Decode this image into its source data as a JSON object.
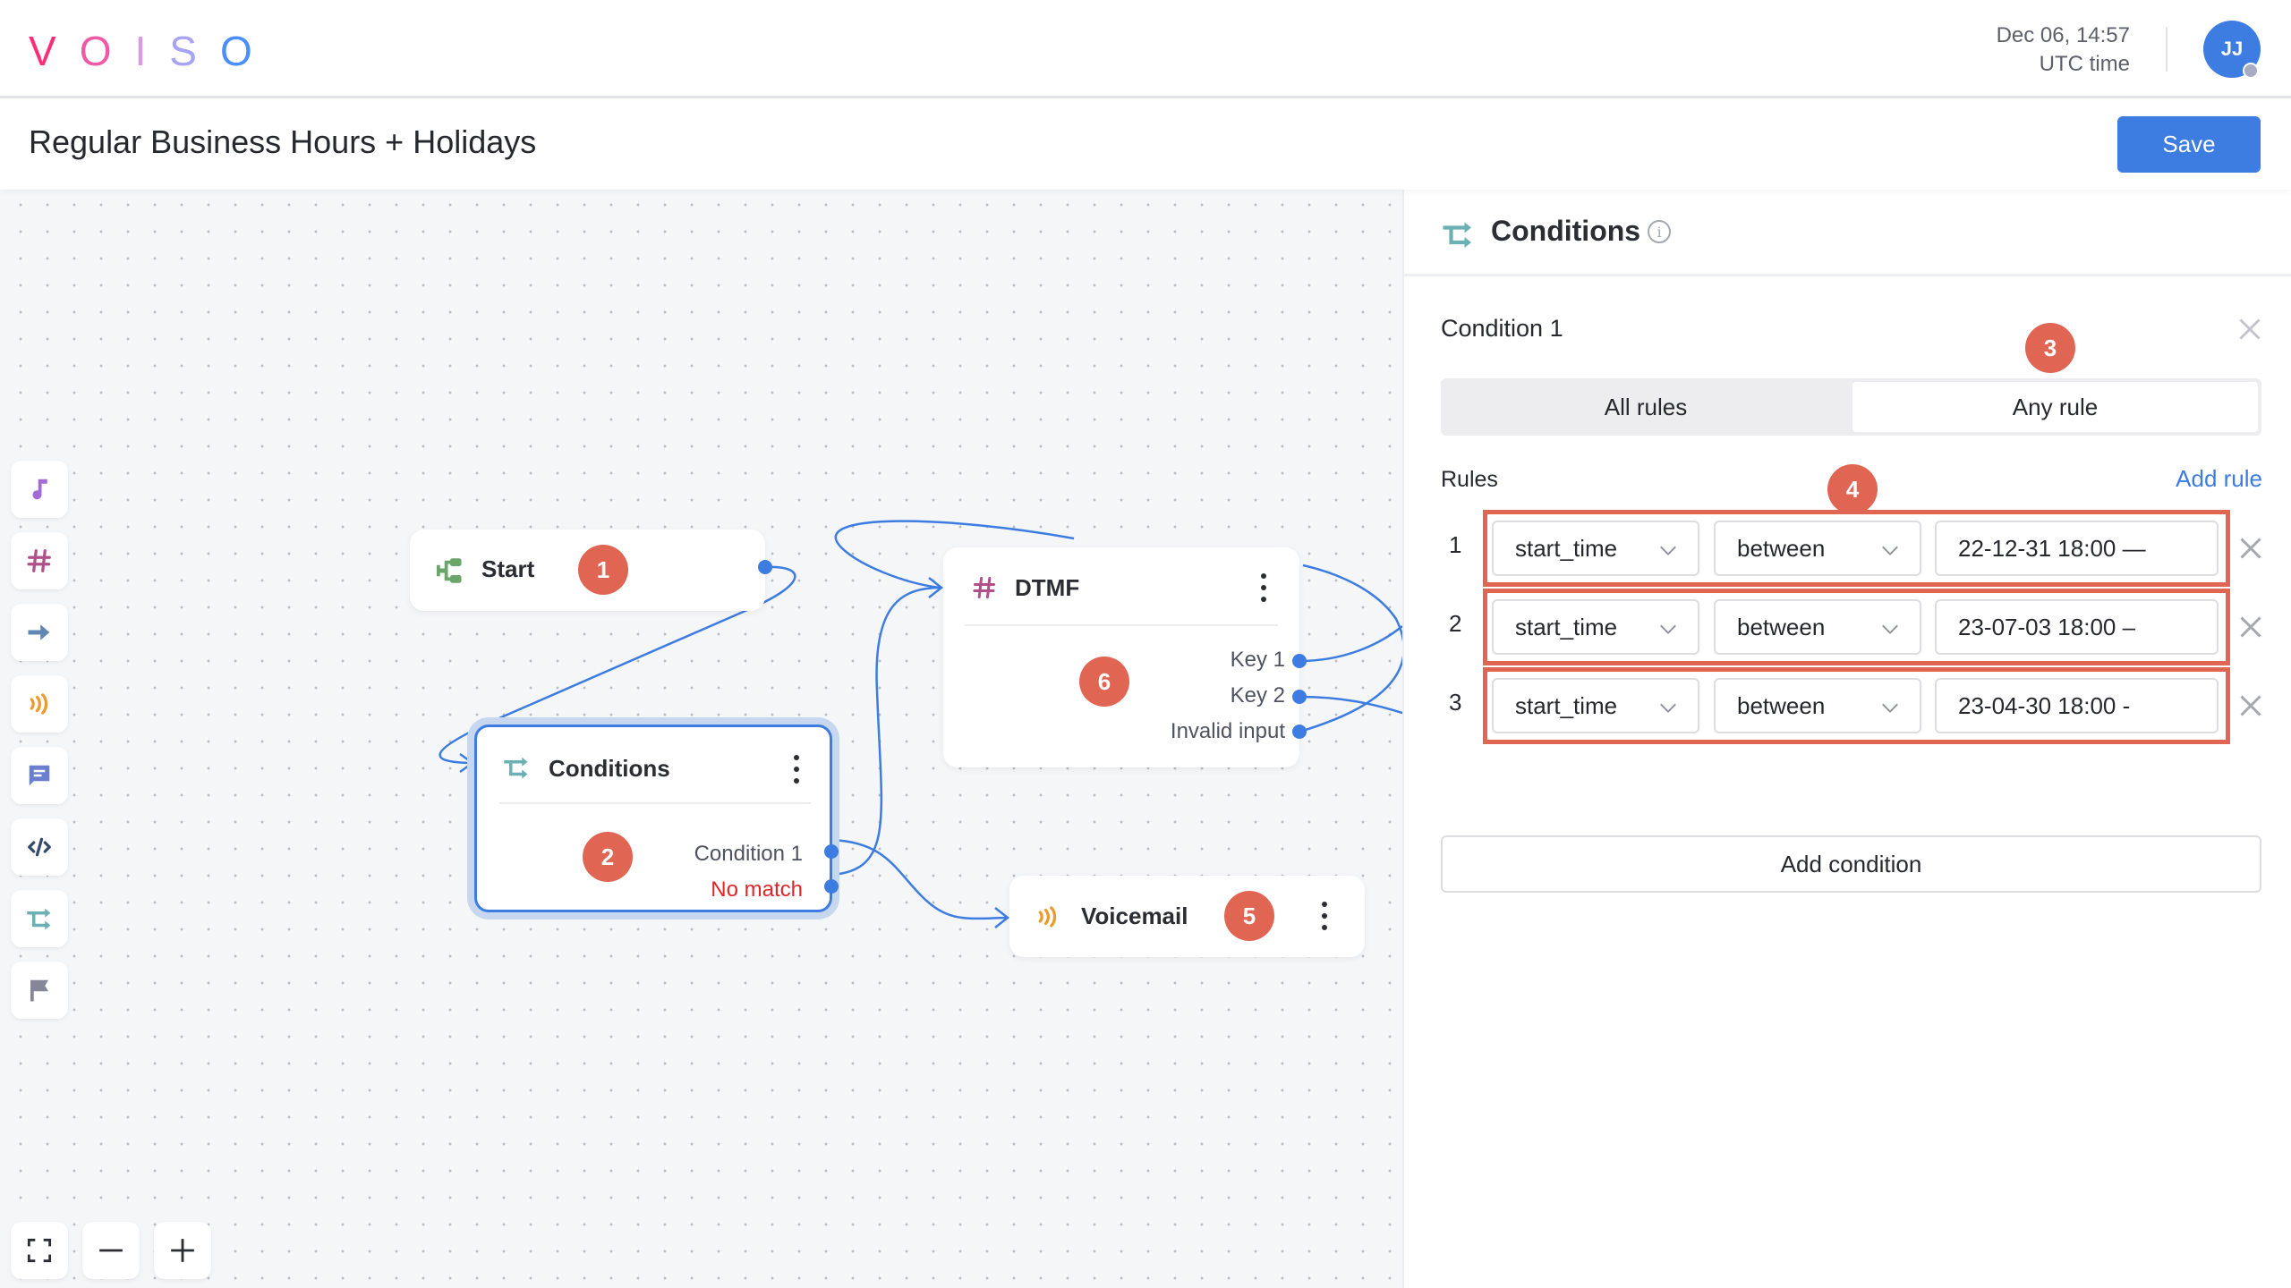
{
  "app": {
    "logo_letters": [
      "V",
      "O",
      "I",
      "S",
      "O"
    ],
    "logo_colors": [
      "#ff2d78",
      "#ef5aa6",
      "#d99be6",
      "#a9a3f6",
      "#4a8ffb"
    ]
  },
  "header": {
    "date_time": "Dec 06, 14:57",
    "timezone": "UTC time",
    "avatar_initials": "JJ",
    "avatar_color": "#3d7ce0",
    "status_color": "#a9abc3"
  },
  "titlebar": {
    "title": "Regular Business Hours + Holidays",
    "save_label": "Save"
  },
  "toolbar": {
    "tools": [
      {
        "icon": "music-note-icon",
        "color": "#a36bd6"
      },
      {
        "icon": "hash-icon",
        "color": "#b0508a"
      },
      {
        "icon": "arrow-right-icon",
        "color": "#5f87b3"
      },
      {
        "icon": "voicemail-waves-icon",
        "color": "#ec9a2b"
      },
      {
        "icon": "message-icon",
        "color": "#6a7fcf"
      },
      {
        "icon": "code-icon",
        "color": "#35496a"
      },
      {
        "icon": "conditions-icon",
        "color": "#6bb0b3"
      },
      {
        "icon": "flag-icon",
        "color": "#85869a"
      }
    ]
  },
  "zoom_controls": {
    "fit": "fit-screen-icon",
    "zoom_out": "minus-icon",
    "zoom_in": "plus-icon"
  },
  "nodes": {
    "start": {
      "title": "Start",
      "badge": "1"
    },
    "conditions": {
      "title": "Conditions",
      "badge": "2",
      "ports": [
        "Condition 1",
        "No match"
      ],
      "no_match_color": "#e0262b"
    },
    "dtmf": {
      "title": "DTMF",
      "badge": "6",
      "ports": [
        "Key 1",
        "Key 2",
        "Invalid input"
      ]
    },
    "voicemail": {
      "title": "Voicemail",
      "badge": "5"
    }
  },
  "panel": {
    "title": "Conditions",
    "info_icon": "i",
    "condition_label": "Condition 1",
    "badge_mode": "3",
    "badge_rules": "4",
    "match_modes": [
      {
        "label": "All rules",
        "selected": false
      },
      {
        "label": "Any rule",
        "selected": true
      }
    ],
    "rules_label": "Rules",
    "add_rule_label": "Add rule",
    "rules": [
      {
        "num": "1",
        "field": "start_time",
        "operator": "between",
        "value": "22-12-31 18:00 —"
      },
      {
        "num": "2",
        "field": "start_time",
        "operator": "between",
        "value": "23-07-03 18:00 –"
      },
      {
        "num": "3",
        "field": "start_time",
        "operator": "between",
        "value": "23-04-30 18:00 -"
      }
    ],
    "add_condition_label": "Add condition"
  },
  "colors": {
    "accent": "#3d7ce0",
    "badge": "#e06553",
    "canvas_bg": "#f5f6f8"
  }
}
